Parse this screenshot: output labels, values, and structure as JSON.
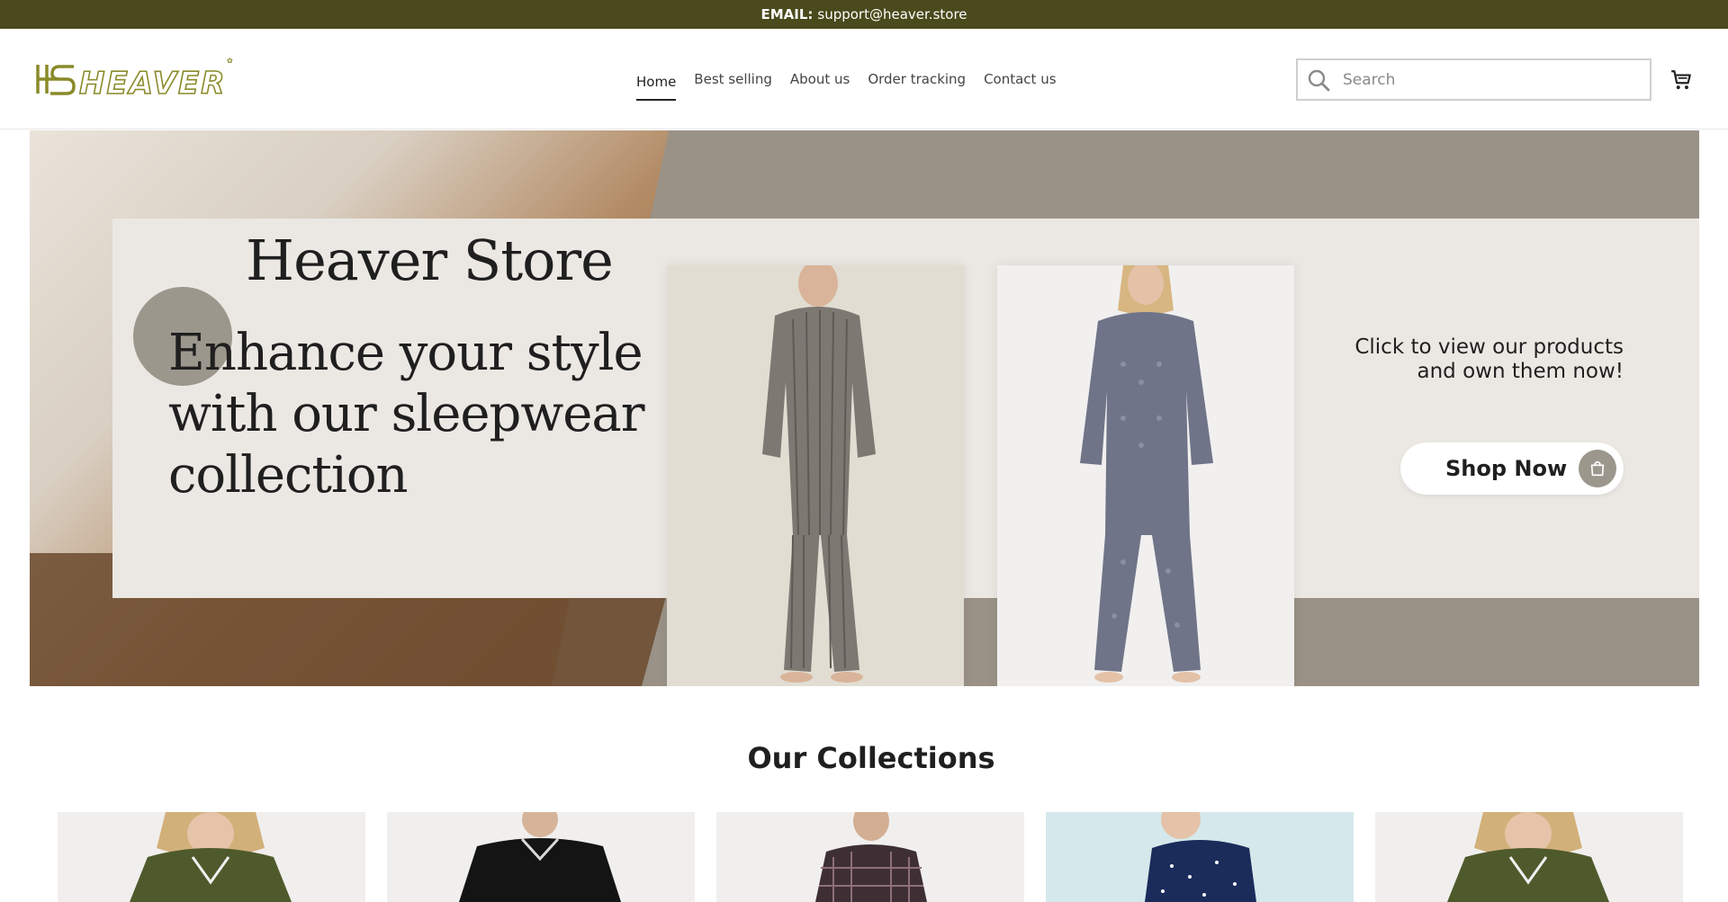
{
  "announcement": {
    "label": "EMAIL:",
    "value": "support@heaver.store"
  },
  "header": {
    "logo_text": "HEAVER",
    "nav": [
      {
        "label": "Home",
        "active": true
      },
      {
        "label": "Best selling",
        "active": false
      },
      {
        "label": "About us",
        "active": false
      },
      {
        "label": "Order tracking",
        "active": false
      },
      {
        "label": "Contact us",
        "active": false
      }
    ],
    "search": {
      "placeholder": "Search",
      "value": ""
    },
    "icons": {
      "search": "search-icon",
      "cart": "cart-icon"
    }
  },
  "hero": {
    "store_name": "Heaver Store",
    "headline": "Enhance your style with our sleepwear collection",
    "cta_text": "Click to view our products and own them now!",
    "button_label": "Shop Now",
    "button_icon": "shopping-bag-icon"
  },
  "collections": {
    "title": "Our Collections",
    "items": [
      {
        "name": "collection-green-pajama-women"
      },
      {
        "name": "collection-black-sleepwear-men"
      },
      {
        "name": "collection-plaid-pajama-men"
      },
      {
        "name": "collection-navy-polka-dot-women"
      },
      {
        "name": "collection-green-pajama-women-2"
      }
    ]
  },
  "colors": {
    "announcement_bg": "#4a4a1c",
    "logo": "#8a8a2a",
    "hero_bg": "#9a9286",
    "hero_card": "#ebe8e3",
    "accent_circle": "#9c978d"
  }
}
